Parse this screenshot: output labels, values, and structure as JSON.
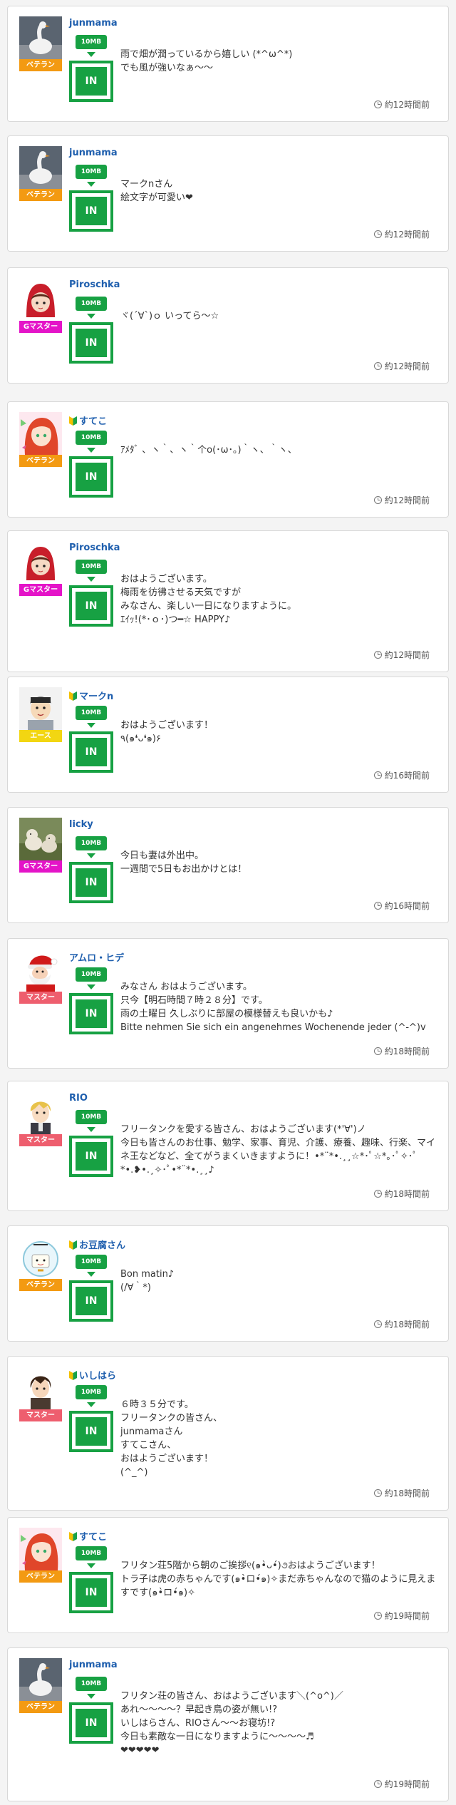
{
  "tank_label": "10MB",
  "in_label": "IN",
  "rank_colors": {
    "ベテラン": "#f39a12",
    "Gマスター": "#e414c8",
    "エース": "#f2d612",
    "マスター": "#ee5e6e"
  },
  "posts": [
    {
      "user": "junmama",
      "rank": "ベテラン",
      "beginner": false,
      "avatar": "swan",
      "message": "雨で畑が潤っているから嬉しい (*^ω^*)\nでも風が強いなぁ〜〜",
      "time": "約12時間前"
    },
    {
      "user": "junmama",
      "rank": "ベテラン",
      "beginner": false,
      "avatar": "swan",
      "message": "マークnさん\n絵文字が可愛い❤",
      "time": "約12時間前"
    },
    {
      "user": "Piroschka",
      "rank": "Gマスター",
      "beginner": false,
      "avatar": "red-hood",
      "message": "ヾ(´∀`)ｏ いってら〜☆",
      "time": "約12時間前"
    },
    {
      "user": "すてこ",
      "rank": "ベテラン",
      "beginner": true,
      "avatar": "redhead-girl",
      "message": "ｱﾒﾀﾞ 、ヽ｀、ヽ｀个o(･ω･｡)｀ヽ、｀ヽ、",
      "time": "約12時間前"
    },
    {
      "user": "Piroschka",
      "rank": "Gマスター",
      "beginner": false,
      "avatar": "red-hood",
      "message": "おはようございます。\n梅雨を彷彿させる天気ですが\nみなさん、楽しい一日になりますように。\nｴｲｯ!(*･ｏ･)つ━☆ HAPPY♪",
      "time": "約12時間前"
    },
    {
      "user": "マークn",
      "rank": "エース",
      "beginner": true,
      "avatar": "boy",
      "message": "おはようございます！\n٩(๑❛ᴗ❛๑)۶",
      "time": "約16時間前"
    },
    {
      "user": "licky",
      "rank": "Gマスター",
      "beginner": false,
      "avatar": "dogs",
      "message": "今日も妻は外出中。\n一週間で5日もお出かけとは！",
      "time": "約16時間前"
    },
    {
      "user": "アムロ・ヒデ",
      "rank": "マスター",
      "beginner": false,
      "avatar": "santa",
      "message": "みなさん おはようございます。\n只今【明石時間７時２８分】です。\n雨の土曜日 久しぶりに部屋の模様替えも良いかも♪\nBitte nehmen Sie sich ein angenehmes Wochenende jeder (^-^)v",
      "time": "約18時間前"
    },
    {
      "user": "RIO",
      "rank": "マスター",
      "beginner": false,
      "avatar": "blond-boy",
      "message": "フリータンクを愛する皆さん、おはようございます(*'∀')ノ\n今日も皆さんのお仕事、勉学、家事、育児、介護、療養、趣味、行楽、マイネ王などなど、全てがうまくいきますように！•*¨*•.¸¸☆*･ﾟ☆*｡･ﾟ✧･ﾟ*•.❥•.¸✧･ﾟ•*¨*•.¸¸♪",
      "time": "約18時間前"
    },
    {
      "user": "お豆腐さん",
      "rank": "ベテラン",
      "beginner": true,
      "avatar": "tofu",
      "message": "Bon matin♪\n(/∀｀*)",
      "time": "約18時間前"
    },
    {
      "user": "いしはら",
      "rank": "マスター",
      "beginner": true,
      "avatar": "dark-boy",
      "message": "６時３５分です。\nフリータンクの皆さん、\njunmamaさん\nすてこさん、\nおはようございます！\n(^_^)",
      "time": "約18時間前"
    },
    {
      "user": "すてこ",
      "rank": "ベテラン",
      "beginner": true,
      "avatar": "redhead-girl",
      "message": "フリタン荘5階から朝のご挨拶୧(๑•̀ᴗ•́)૭おはようございます！\nトラ子は虎の赤ちゃんです(๑•̀ロ•́๑)✧まだ赤ちゃんなので猫のように見えますです(๑•̀ロ•́๑)✧",
      "time": "約19時間前"
    },
    {
      "user": "junmama",
      "rank": "ベテラン",
      "beginner": false,
      "avatar": "swan",
      "message": "フリタン荘の皆さん、おはようございます＼(^o^)／\nあれ〜〜〜〜？早起き鳥の姿が無い!?\nいしはらさん、RIOさん〜〜お寝坊!?\n今日も素敵な一日になりますように〜〜〜〜♬\n❤❤❤❤❤",
      "time": "約19時間前"
    }
  ]
}
